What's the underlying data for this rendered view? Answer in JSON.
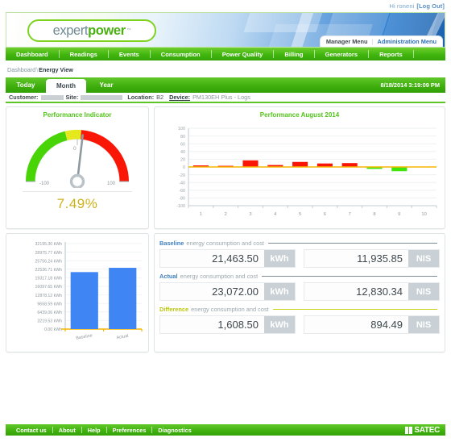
{
  "userbar": {
    "greeting": "Hi roneni",
    "logout": "[Log Out]"
  },
  "brand": {
    "part1": "expert",
    "part2": "power",
    "tm": "™"
  },
  "manager_menu": {
    "manager": "Manager Menu",
    "separator": "|",
    "administration": "Administration Menu"
  },
  "nav": {
    "items": [
      "Dashboard",
      "Readings",
      "Events",
      "Consumption",
      "Power Quality",
      "Billing",
      "Generators",
      "Reports"
    ]
  },
  "breadcrumb": {
    "root": "Dashboard",
    "separator": "\\",
    "current": "Energy View"
  },
  "tabs": {
    "items": [
      "Today",
      "Month",
      "Year"
    ],
    "active": "Month",
    "timestamp": "8/18/2014 3:19:09 PM"
  },
  "info": {
    "customer_label": "Customer:",
    "customer_value": "",
    "site_label": "Site:",
    "site_value": "",
    "location_label": "Location:",
    "location_value": "B2",
    "device_label": "Device:",
    "device_value": "PM130EH Plus - Logs"
  },
  "gauge": {
    "title": "Performance Indicator",
    "value_text": "7.49%",
    "value": 7.49,
    "min_label": "-100",
    "zero_label": "0",
    "max_label": "100",
    "min": -100,
    "max": 100,
    "colors": {
      "green": "#49d408",
      "yellow": "#e6e81e",
      "red": "#fa1607",
      "value_text": "#cdb21a"
    }
  },
  "values": {
    "groups": [
      {
        "name": "baseline",
        "strong": "Baseline",
        "rest": "energy consumption and cost",
        "rule_color": "#7f8e96",
        "strong_color": "#3f7fbf",
        "energy": "21,463.50",
        "energy_unit": "kWh",
        "cost": "11,935.85",
        "cost_unit": "NIS"
      },
      {
        "name": "actual",
        "strong": "Actual",
        "rest": "energy consumption and cost",
        "rule_color": "#7f8e96",
        "strong_color": "#3f7fbf",
        "energy": "23,072.00",
        "energy_unit": "kWh",
        "cost": "12,830.34",
        "cost_unit": "NIS"
      },
      {
        "name": "difference",
        "strong": "Difference",
        "rest": "energy consumption and cost",
        "rule_color": "#c9d418",
        "strong_color": "#b9c40f",
        "energy": "1,608.50",
        "energy_unit": "kWh",
        "cost": "894.49",
        "cost_unit": "NIS"
      }
    ]
  },
  "footer": {
    "items": [
      "Contact us",
      "About",
      "Help",
      "Preferences",
      "Diagnostics"
    ],
    "logo": "SATEC"
  },
  "chart_data": [
    {
      "name": "performance-monthly",
      "type": "bar",
      "title": "Performance August 2014",
      "xlabel": "",
      "ylabel": "",
      "categories": [
        "1",
        "2",
        "3",
        "4",
        "5",
        "6",
        "7",
        "8",
        "9",
        "10"
      ],
      "values": [
        4,
        3,
        17,
        5,
        13,
        9,
        10,
        -5,
        -11,
        0
      ],
      "ylim": [
        -100,
        100
      ],
      "yticks": [
        100,
        80,
        60,
        40,
        20,
        0,
        -20,
        -40,
        -60,
        -80,
        -100
      ],
      "grid": true,
      "legend": "none",
      "positive_color": "#fa1607",
      "negative_color": "#3ee60d",
      "zeroline_color": "#f5b700"
    },
    {
      "name": "baseline-vs-actual",
      "type": "bar",
      "title": "",
      "xlabel": "",
      "ylabel": "kWh",
      "categories": [
        "Baseline",
        "Actual"
      ],
      "values": [
        21463.5,
        23072.0
      ],
      "ylim": [
        0,
        32195.3
      ],
      "yticks": [
        "32195.30 kWh",
        "28975.77 kWh",
        "25756.24 kWh",
        "22536.71 kWh",
        "19317.18 kWh",
        "16097.65 kWh",
        "12878.12 kWh",
        "9658.59 kWh",
        "6439.06 kWh",
        "3219.53 kWh",
        "0.00 kWh"
      ],
      "grid": true,
      "legend": "none",
      "bar_color": "#3f85f4"
    }
  ]
}
